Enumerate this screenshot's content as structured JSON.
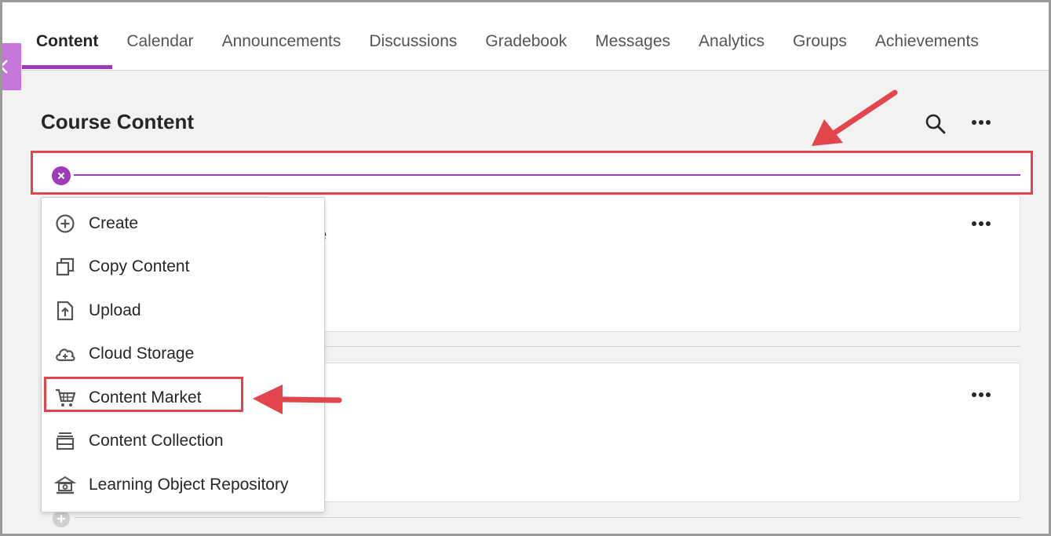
{
  "nav": {
    "tabs": [
      {
        "label": "Content",
        "active": true
      },
      {
        "label": "Calendar"
      },
      {
        "label": "Announcements"
      },
      {
        "label": "Discussions"
      },
      {
        "label": "Gradebook"
      },
      {
        "label": "Messages"
      },
      {
        "label": "Analytics"
      },
      {
        "label": "Groups"
      },
      {
        "label": "Achievements"
      }
    ]
  },
  "page": {
    "title": "Course Content",
    "card_title_fragment": "e"
  },
  "menu": {
    "items": [
      {
        "label": "Create",
        "icon": "plus-circle-icon"
      },
      {
        "label": "Copy Content",
        "icon": "copy-icon"
      },
      {
        "label": "Upload",
        "icon": "upload-file-icon"
      },
      {
        "label": "Cloud Storage",
        "icon": "cloud-plus-icon"
      },
      {
        "label": "Content Market",
        "icon": "cart-icon"
      },
      {
        "label": "Content Collection",
        "icon": "collection-icon"
      },
      {
        "label": "Learning Object Repository",
        "icon": "repository-icon"
      }
    ]
  },
  "colors": {
    "accent": "#9c3ab9",
    "annotation": "#e2454b",
    "collapse_tab": "#c776d9"
  }
}
